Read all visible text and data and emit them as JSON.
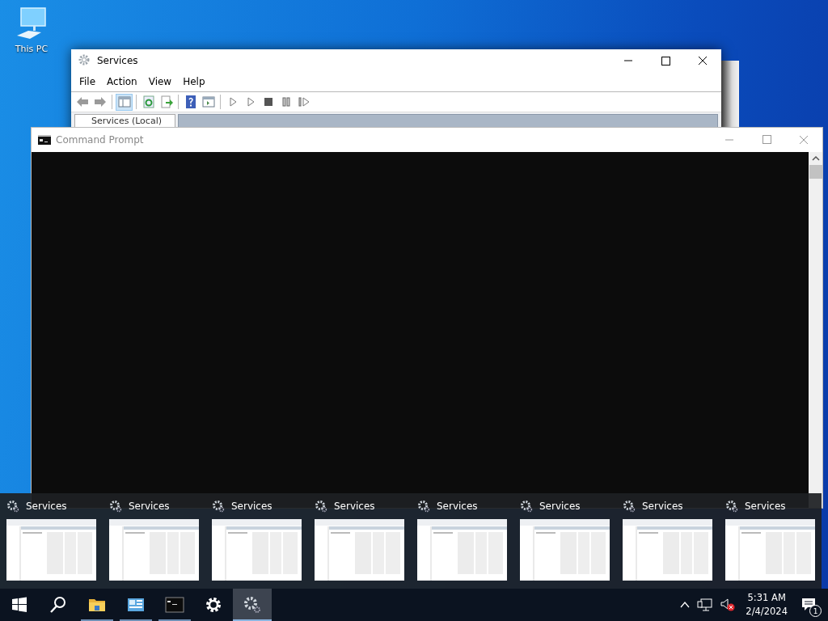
{
  "desktop": {
    "icons": [
      {
        "label": "This PC"
      }
    ]
  },
  "services_window": {
    "title": "Services",
    "menu": [
      "File",
      "Action",
      "View",
      "Help"
    ],
    "toolbar": [
      {
        "kind": "back",
        "disabled": true
      },
      {
        "kind": "forward",
        "disabled": true
      },
      {
        "kind": "tree",
        "pressed": true
      },
      {
        "kind": "refresh"
      },
      {
        "kind": "export"
      },
      {
        "kind": "help"
      },
      {
        "kind": "properties"
      },
      {
        "kind": "start",
        "disabled": true
      },
      {
        "kind": "start",
        "disabled": true
      },
      {
        "kind": "stop",
        "disabled": true
      },
      {
        "kind": "pause",
        "disabled": true
      },
      {
        "kind": "resume",
        "disabled": true
      }
    ],
    "tree_item": "Services (Local)"
  },
  "console_window": {
    "title": "Command Prompt",
    "active": false
  },
  "previews": [
    {
      "title": "Services"
    },
    {
      "title": "Services"
    },
    {
      "title": "Services"
    },
    {
      "title": "Services"
    },
    {
      "title": "Services"
    },
    {
      "title": "Services"
    },
    {
      "title": "Services"
    },
    {
      "title": "Services"
    }
  ],
  "taskbar": {
    "apps": [
      {
        "kind": "start",
        "running": false,
        "selected": false
      },
      {
        "kind": "search",
        "running": false,
        "selected": false
      },
      {
        "kind": "explorer",
        "running": true,
        "selected": false
      },
      {
        "kind": "server",
        "running": true,
        "selected": false
      },
      {
        "kind": "console",
        "running": true,
        "selected": false
      },
      {
        "kind": "settings",
        "running": false,
        "selected": false
      },
      {
        "kind": "services",
        "running": true,
        "selected": true
      }
    ],
    "time": "5:31 AM",
    "date": "2/4/2024",
    "notifications": "1",
    "volume_muted": true
  }
}
